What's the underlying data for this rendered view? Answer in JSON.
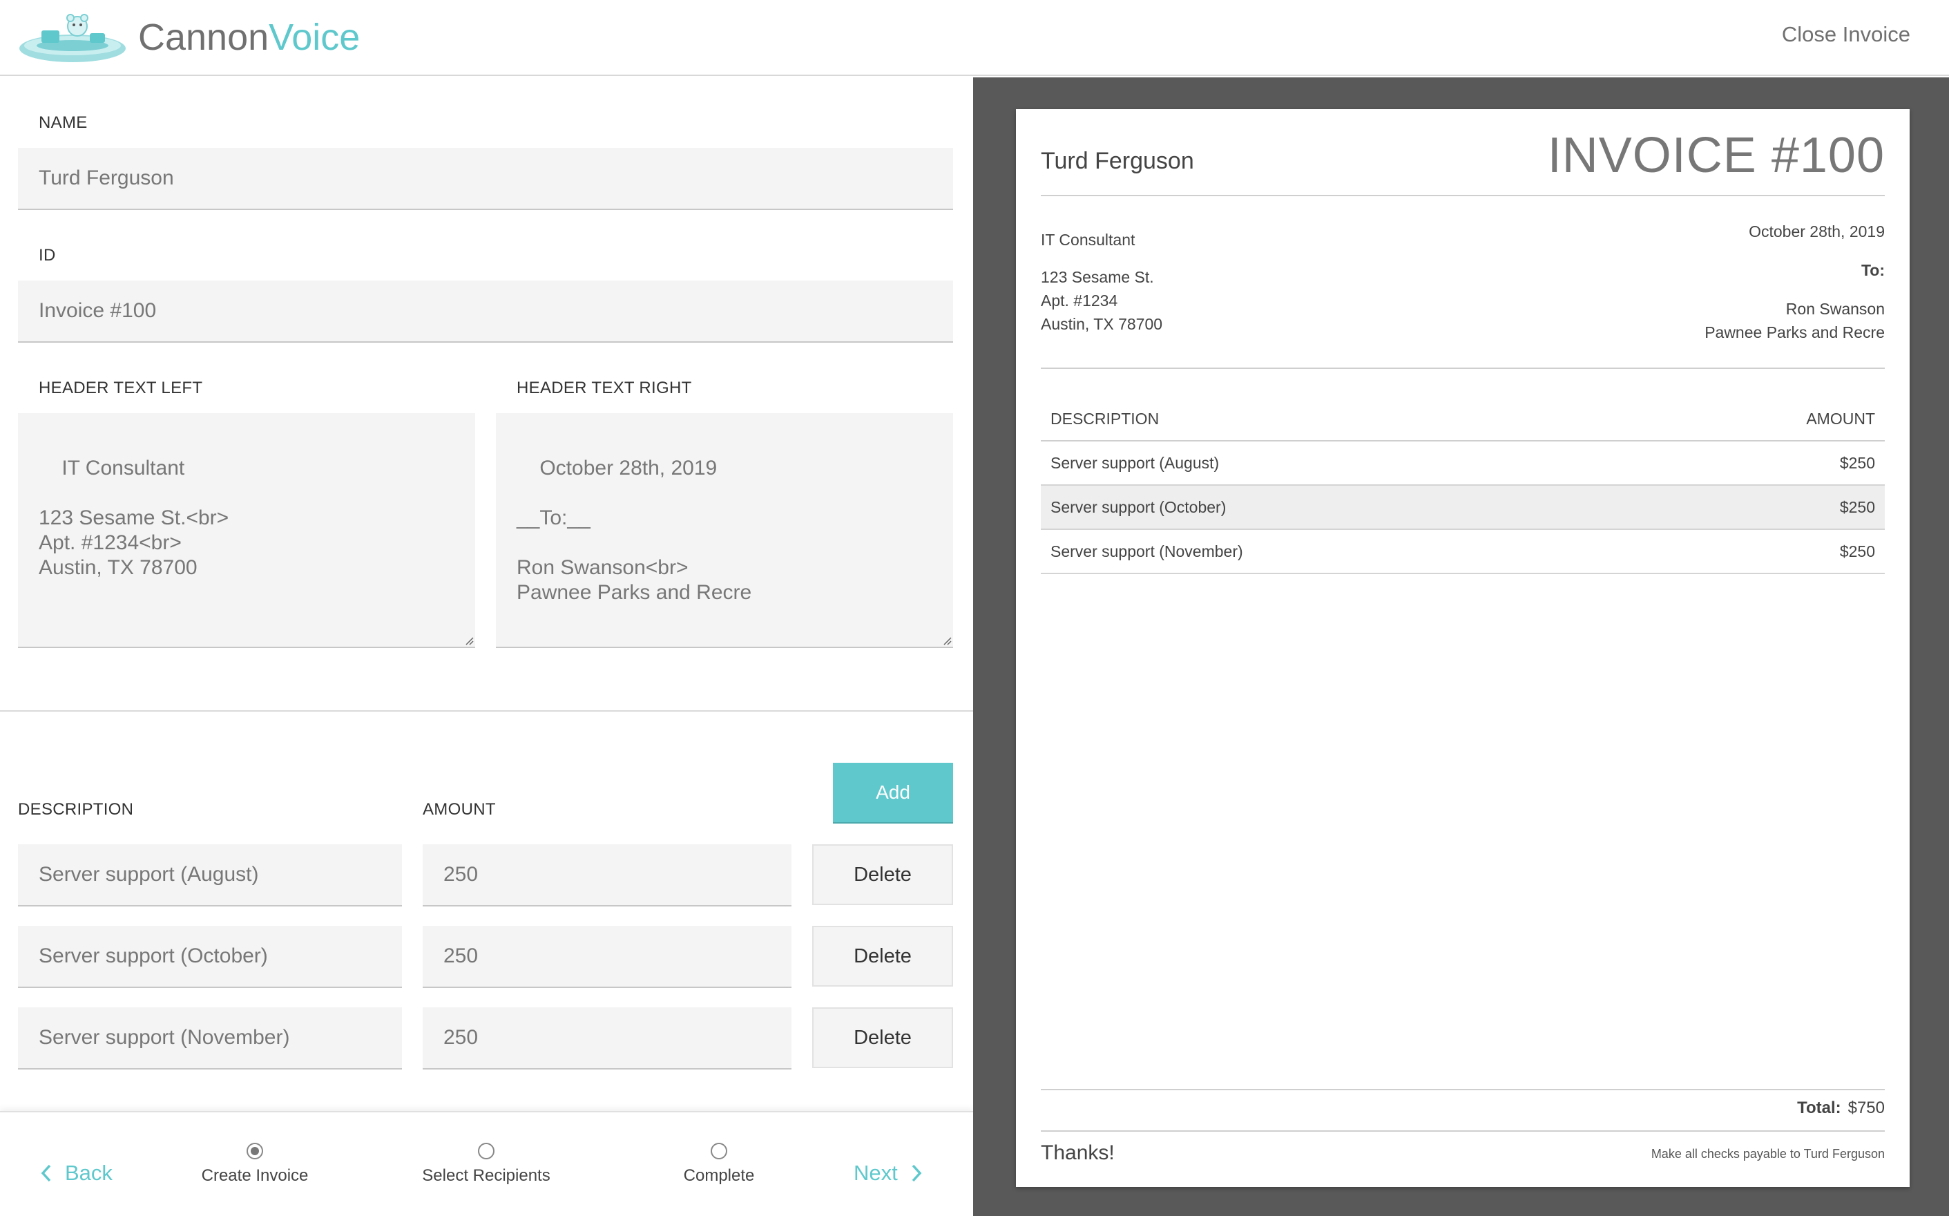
{
  "header": {
    "brand_part1": "Cannon",
    "brand_part2": "Voice",
    "close_label": "Close Invoice",
    "brand_color": "#5ec8cc"
  },
  "form": {
    "name_label": "NAME",
    "name_value": "Turd Ferguson",
    "id_label": "ID",
    "id_value": "Invoice #100",
    "header_left_label": "HEADER TEXT LEFT",
    "header_left_value": "IT Consultant\n\n123 Sesame St.<br>\nApt. #1234<br>\nAustin, TX 78700",
    "header_right_label": "HEADER TEXT RIGHT",
    "header_right_value": "October 28th, 2019\n\n__To:__\n\nRon Swanson<br>\nPawnee Parks and Recre"
  },
  "items": {
    "description_label": "DESCRIPTION",
    "amount_label": "AMOUNT",
    "add_label": "Add",
    "delete_label": "Delete",
    "rows": [
      {
        "description": "Server support (August)",
        "amount": "250"
      },
      {
        "description": "Server support (October)",
        "amount": "250"
      },
      {
        "description": "Server support (November)",
        "amount": "250"
      }
    ]
  },
  "stepper": {
    "back_label": "Back",
    "next_label": "Next",
    "steps": [
      {
        "label": "Create Invoice",
        "active": true
      },
      {
        "label": "Select Recipients",
        "active": false
      },
      {
        "label": "Complete",
        "active": false
      }
    ]
  },
  "preview": {
    "name": "Turd Ferguson",
    "invoice_title": "INVOICE #100",
    "left_lines": [
      "IT Consultant",
      "",
      "123 Sesame St.",
      "Apt. #1234",
      "Austin, TX 78700"
    ],
    "date": "October 28th, 2019",
    "to_label": "To:",
    "to_name": "Ron Swanson",
    "to_org": "Pawnee Parks and Recre",
    "col_description": "DESCRIPTION",
    "col_amount": "AMOUNT",
    "rows": [
      {
        "description": "Server support (August)",
        "amount": "$250"
      },
      {
        "description": "Server support (October)",
        "amount": "$250"
      },
      {
        "description": "Server support (November)",
        "amount": "$250"
      }
    ],
    "total_label": "Total:",
    "total_value": "$750",
    "thanks": "Thanks!",
    "payable_note": "Make all checks payable to Turd Ferguson"
  }
}
